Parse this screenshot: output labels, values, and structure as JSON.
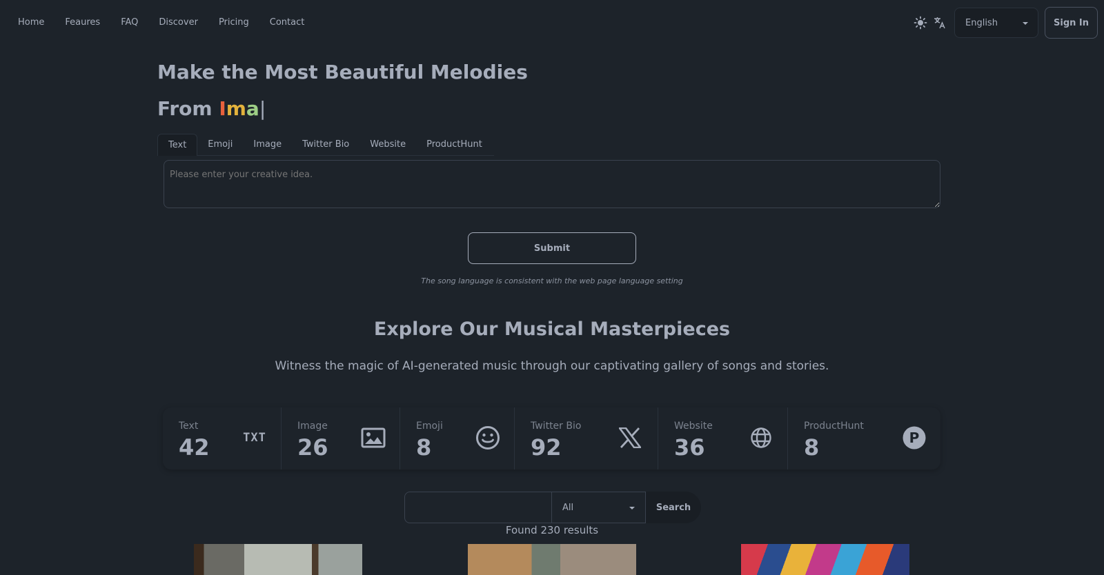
{
  "nav": {
    "links": [
      "Home",
      "Feaures",
      "FAQ",
      "Discover",
      "Pricing",
      "Contact"
    ],
    "theme_icon": "sun-icon",
    "translate_icon": "translate-icon",
    "language": "English",
    "signin_label": "Sign In"
  },
  "hero": {
    "title": "Make the Most Beautiful Melodies",
    "subtitle_prefix": "From ",
    "typed_1": "I",
    "typed_2": "m",
    "typed_3": "a",
    "cursor": "|"
  },
  "tabs": [
    {
      "label": "Text",
      "active": true
    },
    {
      "label": "Emoji",
      "active": false
    },
    {
      "label": "Image",
      "active": false
    },
    {
      "label": "Twitter Bio",
      "active": false
    },
    {
      "label": "Website",
      "active": false
    },
    {
      "label": "ProductHunt",
      "active": false
    }
  ],
  "idea": {
    "placeholder": "Please enter your creative idea."
  },
  "submit_label": "Submit",
  "note": "The song language is consistent with the web page language setting",
  "explore": {
    "title": "Explore Our Musical Masterpieces",
    "subtitle": "Witness the magic of AI-generated music through our captivating gallery of songs and stories."
  },
  "stats": [
    {
      "title": "Text",
      "value": "42",
      "icon": "txt-icon",
      "icon_text": "TXT"
    },
    {
      "title": "Image",
      "value": "26",
      "icon": "image-icon"
    },
    {
      "title": "Emoji",
      "value": "8",
      "icon": "smiley-icon"
    },
    {
      "title": "Twitter Bio",
      "value": "92",
      "icon": "x-logo-icon"
    },
    {
      "title": "Website",
      "value": "36",
      "icon": "globe-icon"
    },
    {
      "title": "ProductHunt",
      "value": "8",
      "icon": "producthunt-icon",
      "icon_text": "P"
    }
  ],
  "search": {
    "filter": "All",
    "button_label": "Search",
    "found": "Found 230 results"
  },
  "colors": {
    "background": "#1d232a",
    "text": "#a6adbb",
    "accent_1": "#e8613c",
    "accent_2": "#e3b23c",
    "accent_3": "#9ecf86"
  }
}
